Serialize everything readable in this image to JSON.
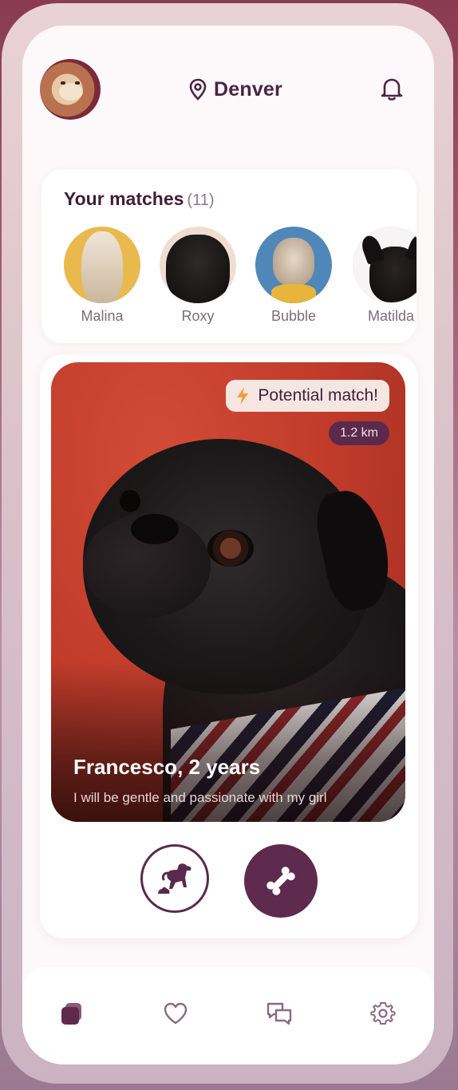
{
  "header": {
    "location": "Denver"
  },
  "matches": {
    "title": "Your matches",
    "count": "(11)",
    "items": [
      {
        "name": "Malina"
      },
      {
        "name": "Roxy"
      },
      {
        "name": "Bubble"
      },
      {
        "name": "Matilda"
      }
    ]
  },
  "card": {
    "badge": "Potential match!",
    "distance": "1.2 km",
    "pet_name": "Francesco, 2 years",
    "bio": "I will be gentle and passionate with my girl"
  },
  "colors": {
    "primary": "#5e2a4e",
    "accent": "#f0a040",
    "background": "#fdf8f9"
  },
  "nav": {
    "items": [
      "cards-icon",
      "heart-icon",
      "chat-icon",
      "gear-icon"
    ],
    "active": "cards-icon"
  }
}
